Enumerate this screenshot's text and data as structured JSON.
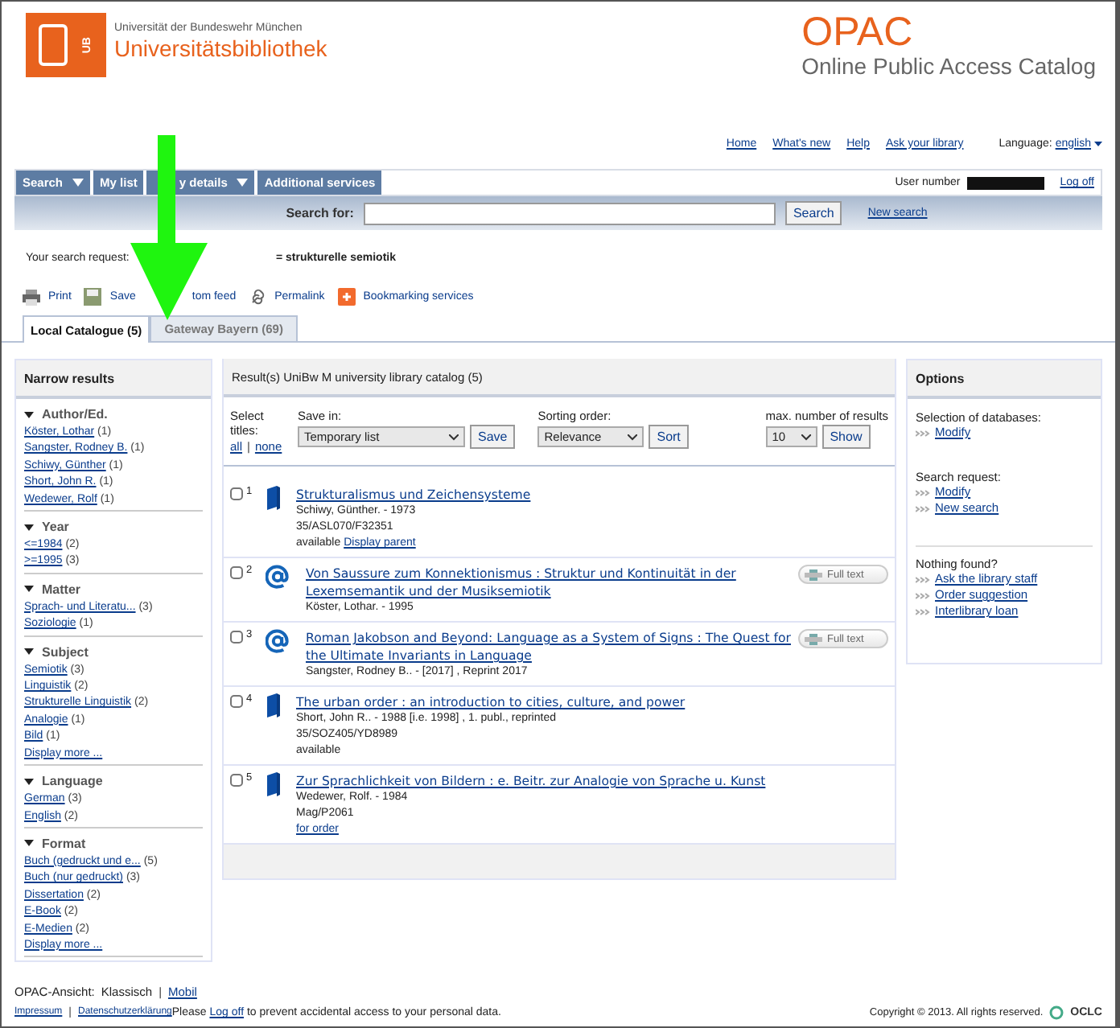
{
  "header": {
    "institution": "Universität der Bundeswehr München",
    "library": "Universitätsbibliothek",
    "logo_mark": "UB",
    "app_title": "OPAC",
    "app_subtitle": "Online Public Access Catalog"
  },
  "top_links": [
    "Home",
    "What's new",
    "Help",
    "Ask your library"
  ],
  "language": {
    "label": "Language:",
    "value": "english"
  },
  "nav": [
    {
      "label": "Search",
      "dropdown": true
    },
    {
      "label": "My list",
      "dropdown": false
    },
    {
      "label": "y details",
      "dropdown": true
    },
    {
      "label": "Additional services",
      "dropdown": false
    }
  ],
  "user": {
    "label": "User number",
    "logoff": "Log off"
  },
  "search": {
    "label": "Search for:",
    "button": "Search",
    "new_search": "New search"
  },
  "request": {
    "prefix": "Your search request:",
    "query": "= strukturelle semiotik"
  },
  "tools": [
    {
      "label": "Print",
      "kind": "print"
    },
    {
      "label": "Save",
      "kind": "save"
    },
    {
      "label": "tom feed",
      "kind": "feed"
    },
    {
      "label": "Permalink",
      "kind": "link"
    },
    {
      "label": "Bookmarking services",
      "kind": "bookmark"
    }
  ],
  "catalog_tabs": [
    {
      "label": "Local Catalogue (5)",
      "selected": true
    },
    {
      "label": "Gateway Bayern (69)",
      "selected": false
    }
  ],
  "narrow": {
    "title": "Narrow results",
    "groups": [
      {
        "title": "Author/Ed.",
        "items": [
          {
            "label": "Köster, Lothar",
            "count": "(1)"
          },
          {
            "label": "Sangster, Rodney B.",
            "count": "(1)"
          },
          {
            "label": "Schiwy, Günther",
            "count": "(1)"
          },
          {
            "label": "Short, John R.",
            "count": "(1)"
          },
          {
            "label": "Wedewer, Rolf",
            "count": "(1)"
          }
        ]
      },
      {
        "title": "Year",
        "items": [
          {
            "label": "<=1984",
            "count": "(2)"
          },
          {
            "label": ">=1995",
            "count": "(3)"
          }
        ]
      },
      {
        "title": "Matter",
        "items": [
          {
            "label": "Sprach- und Literatu...",
            "count": "(3)"
          },
          {
            "label": "Soziologie",
            "count": "(1)"
          }
        ]
      },
      {
        "title": "Subject",
        "items": [
          {
            "label": "Semiotik",
            "count": "(3)"
          },
          {
            "label": "Linguistik",
            "count": "(2)"
          },
          {
            "label": "Strukturelle Linguistik",
            "count": "(2)"
          },
          {
            "label": "Analogie",
            "count": "(1)"
          },
          {
            "label": "Bild",
            "count": "(1)"
          }
        ],
        "more": "Display more ..."
      },
      {
        "title": "Language",
        "items": [
          {
            "label": "German",
            "count": "(3)"
          },
          {
            "label": "English",
            "count": "(2)"
          }
        ]
      },
      {
        "title": "Format",
        "items": [
          {
            "label": "Buch (gedruckt und e...",
            "count": "(5)"
          },
          {
            "label": "Buch (nur gedruckt)",
            "count": "(3)"
          },
          {
            "label": "Dissertation",
            "count": "(2)"
          },
          {
            "label": "E-Book",
            "count": "(2)"
          },
          {
            "label": "E-Medien",
            "count": "(2)"
          }
        ],
        "more": "Display more ..."
      }
    ]
  },
  "results": {
    "title": "Result(s) UniBw M university library catalog (5)",
    "select": {
      "label": "Select titles:",
      "all": "all",
      "separator": "|",
      "none": "none"
    },
    "save": {
      "label": "Save in:",
      "value": "Temporary list",
      "button": "Save"
    },
    "sort": {
      "label": "Sorting order:",
      "value": "Relevance",
      "button": "Sort"
    },
    "max": {
      "label": "max. number of results",
      "value": "10",
      "button": "Show"
    },
    "items": [
      {
        "number": "1",
        "kind": "book",
        "checked": false,
        "title": "Strukturalismus und Zeichensysteme",
        "lines": [
          {
            "text": "Schiwy, Günther. -  1973"
          },
          {
            "text": "35/ASL070/F32351"
          },
          {
            "text": "available",
            "link": "Display parent"
          }
        ]
      },
      {
        "number": "2",
        "kind": "online",
        "checked": false,
        "title": "Von Saussure zum Konnektionismus : Struktur und Kontinuität in der Lexemsemantik und der Musiksemiotik",
        "full_text": "Full text",
        "lines": [
          {
            "text": "Köster, Lothar. -  1995"
          }
        ]
      },
      {
        "number": "3",
        "kind": "online",
        "checked": false,
        "title": "Roman Jakobson and Beyond: Language as a System of Signs : The Quest for the Ultimate Invariants in Language",
        "full_text": "Full text",
        "lines": [
          {
            "text": "Sangster, Rodney B.. -  [2017] , Reprint 2017"
          }
        ]
      },
      {
        "number": "4",
        "kind": "book",
        "checked": false,
        "title": "The urban order : an introduction to cities, culture, and power",
        "lines": [
          {
            "text": "Short, John R.. -  1988 [i.e. 1998] , 1. publ., reprinted"
          },
          {
            "text": "35/SOZ405/YD8989"
          },
          {
            "text": "available"
          }
        ]
      },
      {
        "number": "5",
        "kind": "book",
        "checked": false,
        "title": "Zur Sprachlichkeit von Bildern : e. Beitr. zur Analogie von Sprache u. Kunst",
        "lines": [
          {
            "text": "Wedewer, Rolf. -  1984"
          },
          {
            "text": "Mag/P2061"
          },
          {
            "link": "for order"
          }
        ]
      }
    ]
  },
  "options": {
    "title": "Options",
    "sections": [
      {
        "heading": "Selection of databases:",
        "links": [
          "Modify"
        ],
        "divider_before": false
      },
      {
        "heading": "Search request:",
        "links": [
          "Modify",
          "New search"
        ],
        "divider_before": false
      },
      {
        "heading": "Nothing found?",
        "links": [
          "Ask the library staff",
          "Order suggestion",
          "Interlibrary loan"
        ],
        "divider_before": true
      }
    ]
  },
  "footer": {
    "view_label": "OPAC-Ansicht:",
    "view_current": "Klassisch",
    "view_separator": "|",
    "view_other": "Mobil",
    "links": [
      "Impressum",
      "Datenschutzerklärung"
    ],
    "link_separator": "|",
    "notice_before": "Please",
    "notice_link": "Log off",
    "notice_after": "to prevent accidental access to your personal data.",
    "copyright": "Copyright © 2013. All rights reserved.",
    "vendor": "OCLC"
  }
}
